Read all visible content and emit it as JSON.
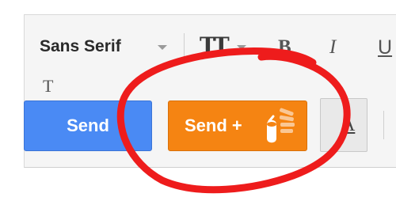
{
  "toolbar": {
    "font_name": "Sans Serif",
    "size_icon_glyph": "TT",
    "bold_glyph": "B",
    "italic_glyph": "I",
    "underline_glyph": "U",
    "clear_format_glyph": "T"
  },
  "actions": {
    "send_label": "Send",
    "send_plus_label": "Send +",
    "format_glyph": "A"
  },
  "icons": {
    "send_plus_icon": "multi-send-icon",
    "font_caret": "chevron-down-icon",
    "size_caret": "chevron-down-icon"
  },
  "colors": {
    "send_blue": "#4a8af4",
    "send_plus_orange": "#f58412",
    "annotation_red": "#ee1c1c"
  }
}
